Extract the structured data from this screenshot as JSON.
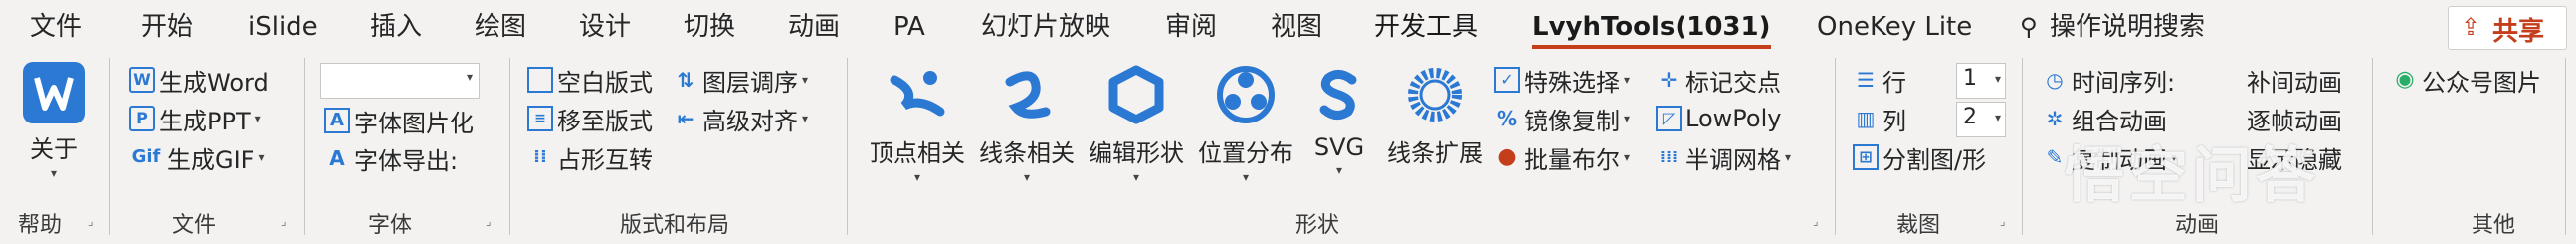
{
  "tabs": [
    {
      "label": "文件"
    },
    {
      "label": "开始"
    },
    {
      "label": "iSlide"
    },
    {
      "label": "插入"
    },
    {
      "label": "绘图"
    },
    {
      "label": "设计"
    },
    {
      "label": "切换"
    },
    {
      "label": "动画"
    },
    {
      "label": "PA"
    },
    {
      "label": "幻灯片放映"
    },
    {
      "label": "审阅"
    },
    {
      "label": "视图"
    },
    {
      "label": "开发工具"
    },
    {
      "label": "LvyhTools(1031)"
    },
    {
      "label": "OneKey Lite"
    }
  ],
  "search_label": "操作说明搜索",
  "share_label": "共享",
  "accent_color": "#c43e1c",
  "groups": {
    "help": {
      "label": "帮助",
      "about": "关于"
    },
    "file": {
      "label": "文件",
      "word": "生成Word",
      "ppt": "生成PPT",
      "gif": "生成GIF"
    },
    "font": {
      "label": "字体",
      "font_image": "字体图片化",
      "font_export": "字体导出:"
    },
    "layout": {
      "label": "版式和布局",
      "blank": "空白版式",
      "move": "移至版式",
      "placeholder": "占形互转",
      "layer": "图层调序",
      "align": "高级对齐"
    },
    "shape": {
      "label": "形状",
      "vertex": "顶点相关",
      "line": "线条相关",
      "edit": "编辑形状",
      "position": "位置分布",
      "svg": "SVG",
      "expand": "线条扩展",
      "special": "特殊选择",
      "mirror": "镜像复制",
      "boolean": "批量布尔",
      "mark": "标记交点",
      "lowpoly": "LowPoly",
      "halftone": "半调网格"
    },
    "crop": {
      "label": "裁图",
      "row": "行",
      "col": "列",
      "row_val": "1",
      "col_val": "2",
      "split": "分割图/形"
    },
    "anim": {
      "label": "动画",
      "seq": "时间序列:",
      "combo": "组合动画",
      "copy": "复制动画",
      "tween": "补间动画",
      "step": "逐帧动画",
      "show": "显示隐藏"
    },
    "other": {
      "label": "其他",
      "wechat": "公众号图片"
    }
  },
  "watermark": "悟空问答"
}
